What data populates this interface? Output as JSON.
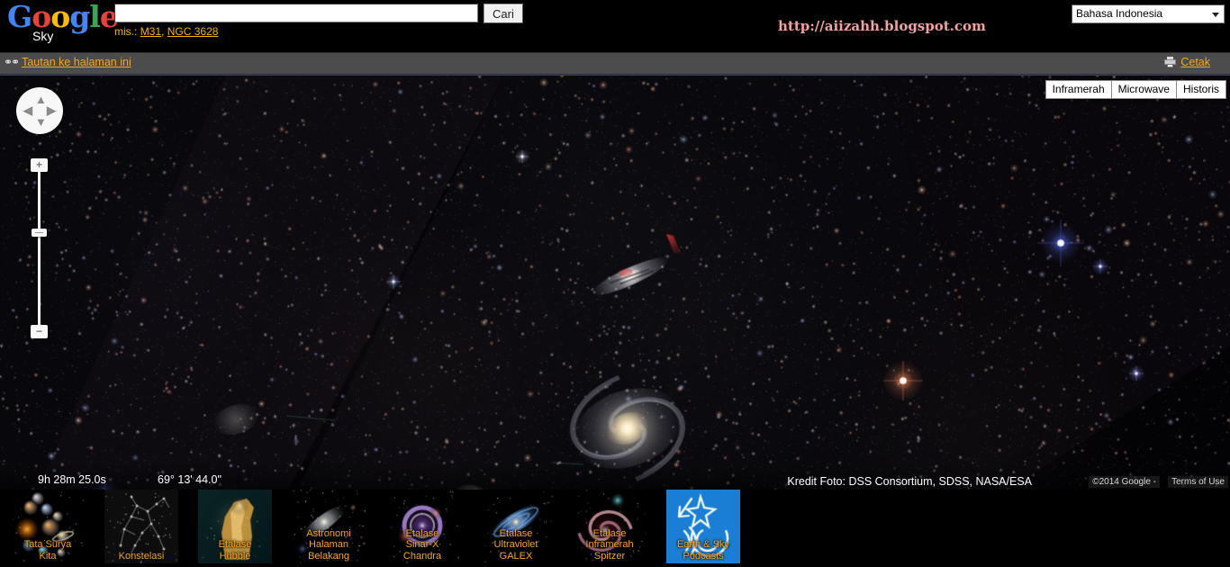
{
  "header": {
    "logo": {
      "text": "Google",
      "tm": "™",
      "sub": "Sky"
    },
    "search": {
      "value": "",
      "placeholder": "",
      "button_label": "Cari"
    },
    "examples_prefix": "mis.:",
    "examples": [
      {
        "label": "M31"
      },
      {
        "label": "NGC 3628"
      }
    ],
    "blog_url": "http://aiizahh.blogspot.com",
    "language": {
      "selected": "Bahasa Indonesia"
    }
  },
  "linkbar": {
    "link_icon": "chain-link-icon",
    "link_label": "Tautan ke halaman ini",
    "print_icon": "printer-icon",
    "print_label": "Cetak"
  },
  "map": {
    "maptypes": [
      {
        "label": "Inframerah",
        "active": false
      },
      {
        "label": "Microwave",
        "active": false
      },
      {
        "label": "Historis",
        "active": false
      }
    ],
    "pan": {
      "up": "▲",
      "down": "▼",
      "left": "◀",
      "right": "▶"
    },
    "zoom": {
      "in_label": "+",
      "out_label": "−",
      "level_fraction": 0.62
    },
    "coordinates": {
      "ra": "9h 28m 25.0s",
      "dec": "69° 13' 44.0\""
    },
    "credits": {
      "photo": "Kredit Foto: DSS Consortium, SDSS, NASA/ESA",
      "google": "©2014 Google -",
      "terms": "Terms of Use"
    }
  },
  "strip": {
    "items": [
      {
        "name": "tata-surya-kita",
        "lines": [
          "Tata Surya",
          "Kita"
        ],
        "art": "solar-system"
      },
      {
        "name": "konstelasi",
        "lines": [
          "Konstelasi"
        ],
        "art": "constellation"
      },
      {
        "name": "etalase-hubble",
        "lines": [
          "Etalase",
          "Hubble"
        ],
        "art": "hubble-pillar"
      },
      {
        "name": "astronomi-halaman-belakang",
        "lines": [
          "Astronomi",
          "Halaman",
          "Belakang"
        ],
        "art": "backyard-galaxy"
      },
      {
        "name": "etalase-sinar-x-chandra",
        "lines": [
          "Etalase",
          "Sinar-X",
          "Chandra"
        ],
        "art": "chandra-remnant"
      },
      {
        "name": "etalase-ultraviolet-galex",
        "lines": [
          "Etalase",
          "Ultraviolet",
          "GALEX"
        ],
        "art": "galex-andromeda"
      },
      {
        "name": "etalase-inframerah-spitzer",
        "lines": [
          "Etalase",
          "Inframerah",
          "Spitzer"
        ],
        "art": "spitzer-whirlpool"
      },
      {
        "name": "earth-and-sky-podcasts",
        "lines": [
          "Earth & Sky",
          "Podcasts"
        ],
        "art": "earthsky-logo"
      }
    ]
  },
  "colors": {
    "accent_orange": "#f5a623",
    "linkbar_bg": "#4c4c4c",
    "map_bg": "#050408",
    "blog_url_color": "#f2a0a0"
  }
}
